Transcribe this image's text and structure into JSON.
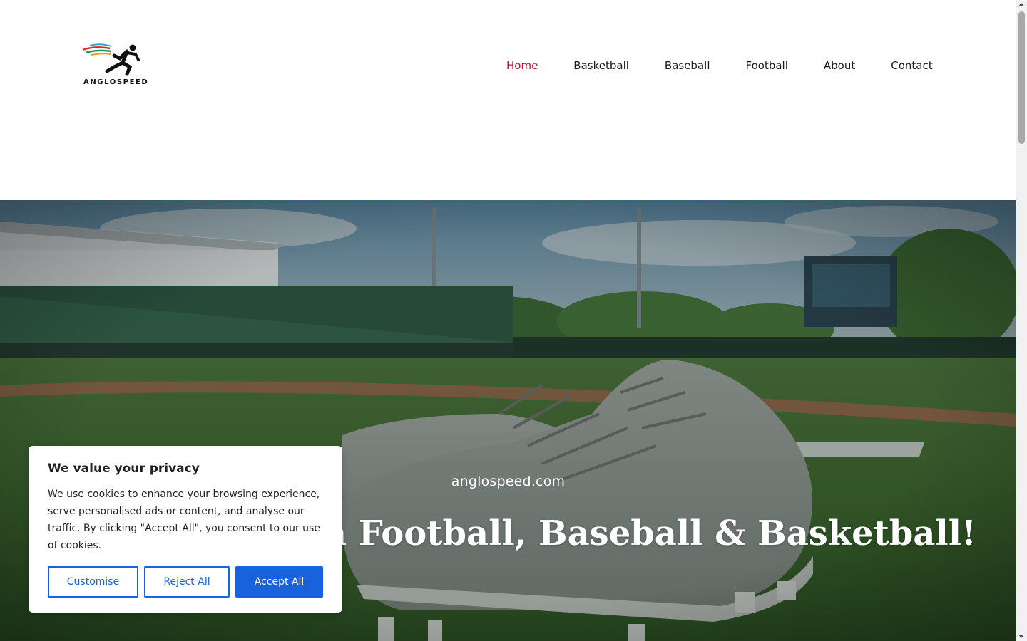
{
  "brand": {
    "logo_text": "ANGLOSPEED"
  },
  "nav": {
    "items": [
      {
        "label": "Home",
        "active": true
      },
      {
        "label": "Basketball",
        "active": false
      },
      {
        "label": "Baseball",
        "active": false
      },
      {
        "label": "Football",
        "active": false
      },
      {
        "label": "About",
        "active": false
      },
      {
        "label": "Contact",
        "active": false
      }
    ]
  },
  "hero": {
    "subtitle": "anglospeed.com",
    "title": "Best in Football, Baseball & Basketball!"
  },
  "cookie_banner": {
    "title": "We value your privacy",
    "text": "We use cookies to enhance your browsing experience, serve personalised ads or content, and analyse our traffic. By clicking \"Accept All\", you consent to our use of cookies.",
    "customise_label": "Customise",
    "reject_label": "Reject All",
    "accept_label": "Accept All"
  },
  "colors": {
    "nav_active": "#c8102e",
    "accent_blue": "#1863dc"
  }
}
